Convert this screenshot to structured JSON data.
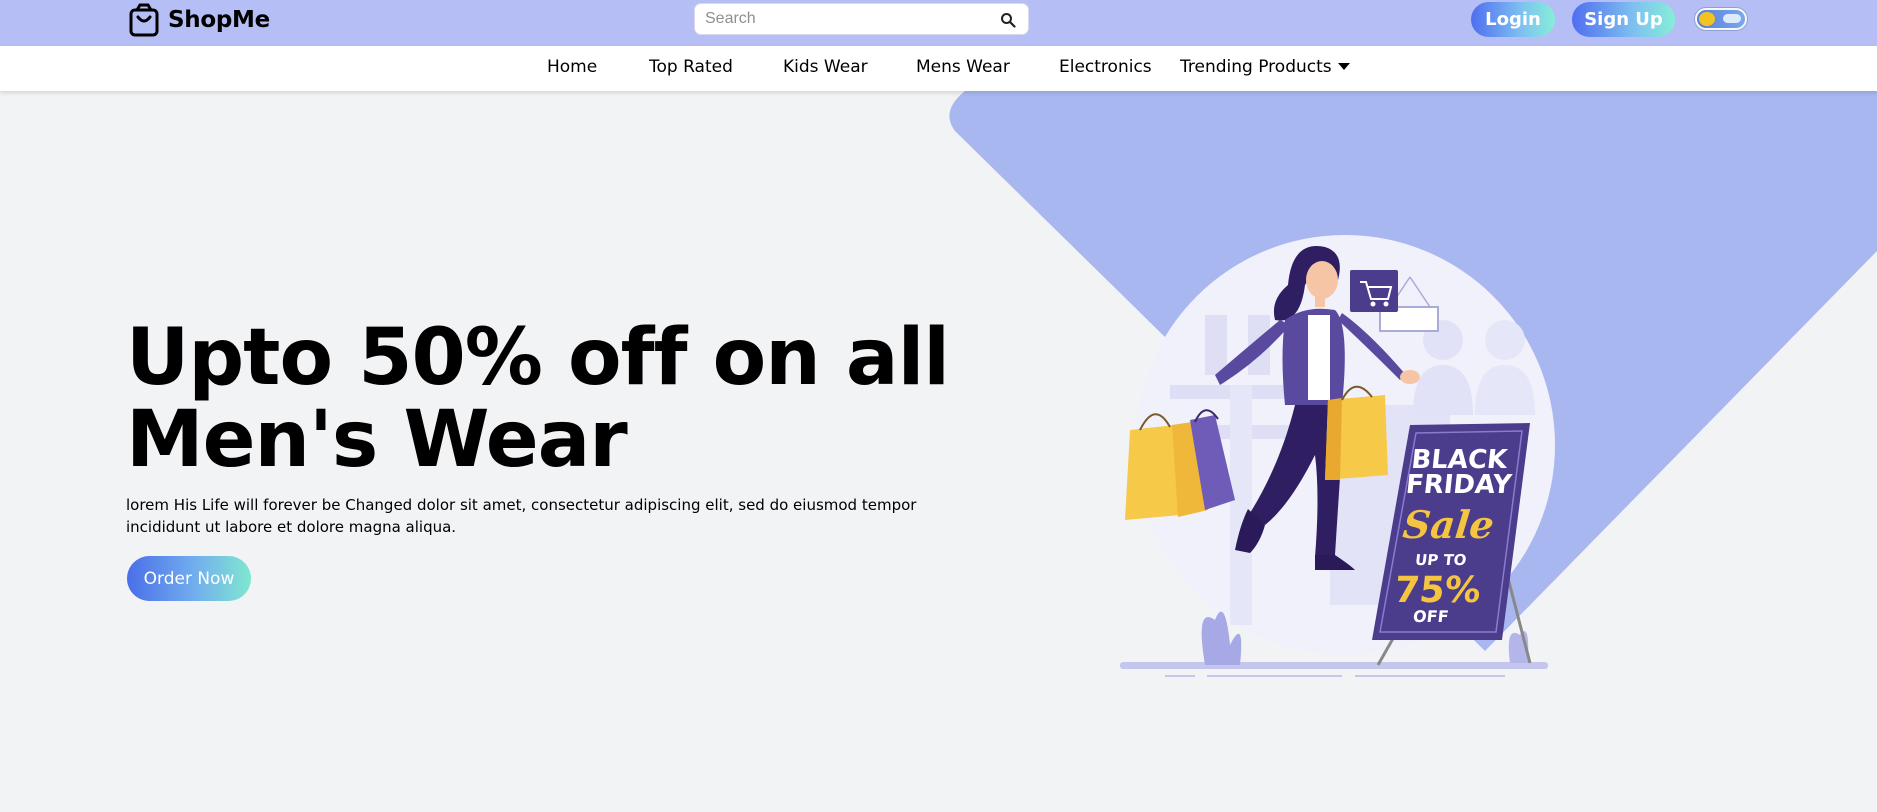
{
  "header": {
    "brand": "ShopMe",
    "search_placeholder": "Search",
    "login_label": "Login",
    "signup_label": "Sign Up"
  },
  "nav": {
    "items": [
      "Home",
      "Top Rated",
      "Kids Wear",
      "Mens Wear",
      "Electronics"
    ],
    "dropdown_label": "Trending Products"
  },
  "hero": {
    "headline_line1": "Upto 50% off on all",
    "headline_line2": "Men's Wear",
    "description": "lorem His Life will forever be Changed dolor sit amet, consectetur adipiscing elit, sed do eiusmod tempor incididunt ut labore et dolore magna aliqua.",
    "cta_label": "Order Now",
    "sign_text": {
      "line1": "BLACK",
      "line2": "FRIDAY",
      "line3": "Sale",
      "line4": "UP TO",
      "line5": "75%",
      "line6": "OFF"
    }
  },
  "colors": {
    "topbar": "#b5bff5",
    "hero_shape": "#a9b7f1",
    "page_bg": "#f2f3f5",
    "gradient_start": "#4f6ef0",
    "gradient_end": "#85eed8"
  },
  "icons": {
    "brand": "shopping-bag-icon",
    "search": "search-icon",
    "dropdown": "caret-down-icon",
    "theme": "theme-toggle"
  }
}
